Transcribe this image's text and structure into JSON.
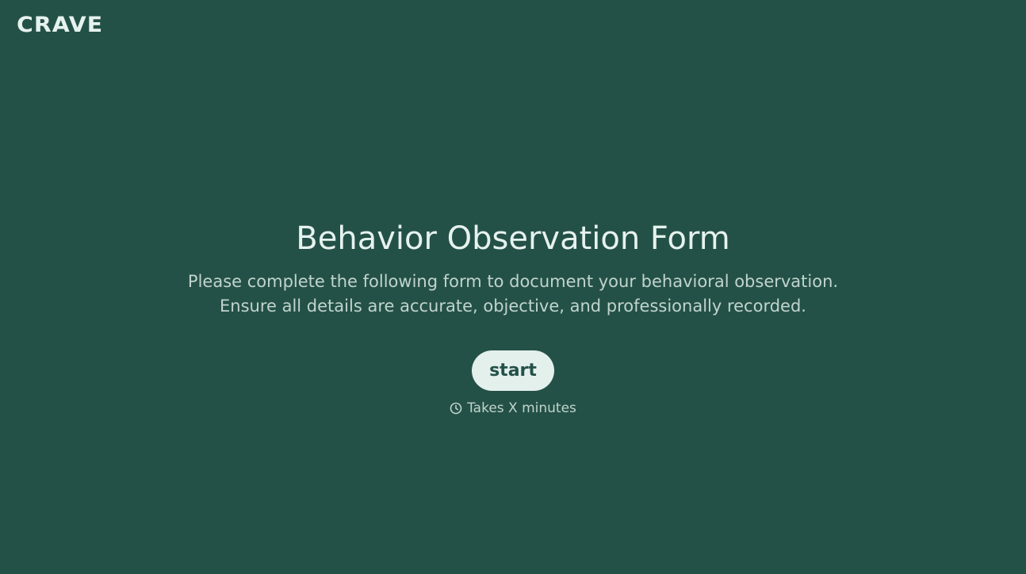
{
  "header": {
    "logo_text": "CRAVE"
  },
  "main": {
    "title": "Behavior Observation Form",
    "subtitle_line1": "Please complete the following form to document your behavioral observation.",
    "subtitle_line2": "Ensure all details are accurate, objective, and professionally recorded.",
    "start_label": "start",
    "duration_text": "Takes X minutes",
    "duration_icon": "clock-icon"
  },
  "colors": {
    "background": "#245147",
    "text_primary": "#e6f2ee",
    "text_secondary": "#c0d4cd",
    "button_bg": "#e3f0ec",
    "button_text": "#245147"
  }
}
